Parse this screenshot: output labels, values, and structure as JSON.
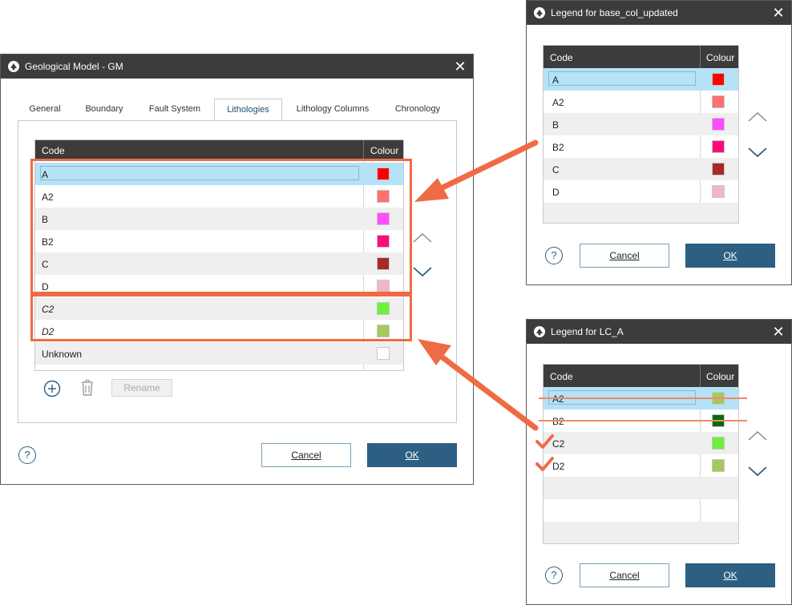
{
  "main_dialog": {
    "title": "Geological Model - GM",
    "tabs": [
      "General",
      "Boundary",
      "Fault System",
      "Lithologies",
      "Lithology Columns",
      "Chronology"
    ],
    "active_tab": "Lithologies",
    "grid": {
      "col_code": "Code",
      "col_colour": "Colour",
      "rows": [
        {
          "code": "A",
          "color": "#ff0000"
        },
        {
          "code": "A2",
          "color": "#ff7070"
        },
        {
          "code": "B",
          "color": "#ff4dff"
        },
        {
          "code": "B2",
          "color": "#ff0a78"
        },
        {
          "code": "C",
          "color": "#a52a2a"
        },
        {
          "code": "D",
          "color": "#f0b8c4"
        },
        {
          "code": "C2",
          "color": "#6ef03c"
        },
        {
          "code": "D2",
          "color": "#a6c95a"
        },
        {
          "code": "Unknown",
          "color": "#ffffff"
        }
      ]
    },
    "rename_label": "Rename",
    "help": "?",
    "cancel_label": "Cancel",
    "ok_label": "OK"
  },
  "legend_base": {
    "title": "Legend for base_col_updated",
    "col_code": "Code",
    "col_colour": "Colour",
    "rows": [
      {
        "code": "A",
        "color": "#ff0000"
      },
      {
        "code": "A2",
        "color": "#ff7070"
      },
      {
        "code": "B",
        "color": "#ff4dff"
      },
      {
        "code": "B2",
        "color": "#ff0a78"
      },
      {
        "code": "C",
        "color": "#a52a2a"
      },
      {
        "code": "D",
        "color": "#f0b8c4"
      }
    ],
    "help": "?",
    "cancel_label": "Cancel",
    "ok_label": "OK"
  },
  "legend_lca": {
    "title": "Legend for LC_A",
    "col_code": "Code",
    "col_colour": "Colour",
    "rows": [
      {
        "code": "A2",
        "color": "#a6c95a"
      },
      {
        "code": "B2",
        "color": "#0b6a0b"
      },
      {
        "code": "C2",
        "color": "#6ef03c"
      },
      {
        "code": "D2",
        "color": "#a6c95a"
      }
    ],
    "help": "?",
    "cancel_label": "Cancel",
    "ok_label": "OK"
  },
  "colors": {
    "titlebar": "#3c3c3c",
    "accent": "#2c5f82",
    "selection": "#b5e2f7",
    "annotation": "#ef6b45"
  }
}
